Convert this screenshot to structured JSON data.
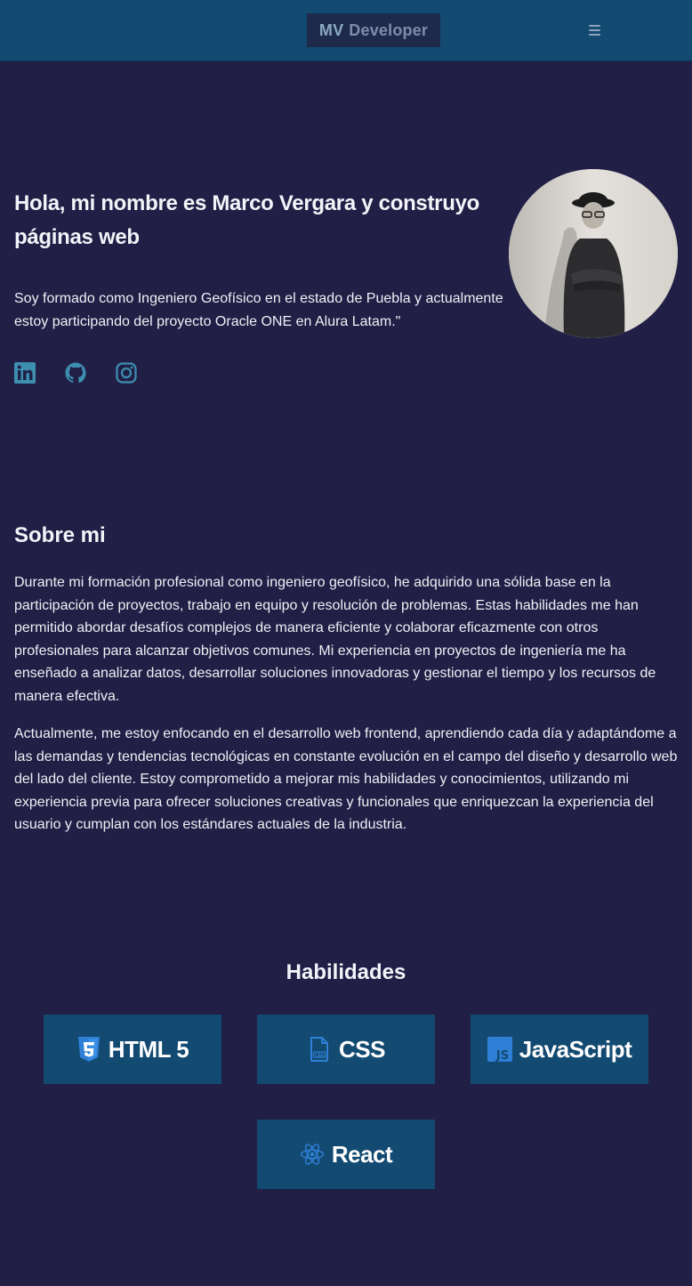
{
  "header": {
    "logo_initials": "MV",
    "logo_text": "Developer",
    "menu_icon": "hamburger-icon"
  },
  "hero": {
    "title": "Hola, mi nombre es Marco Vergara y construyo páginas web",
    "text": "Soy formado como Ingeniero Geofísico en el estado de Puebla y actualmente estoy participando del proyecto Oracle ONE en Alura Latam.\"",
    "socials": [
      {
        "icon": "linkedin-icon"
      },
      {
        "icon": "github-icon"
      },
      {
        "icon": "instagram-icon"
      }
    ]
  },
  "about": {
    "title": "Sobre mi",
    "paragraphs": [
      "Durante mi formación profesional como ingeniero geofísico, he adquirido una sólida base en la participación de proyectos, trabajo en equipo y resolución de problemas. Estas habilidades me han permitido abordar desafíos complejos de manera eficiente y colaborar eficazmente con otros profesionales para alcanzar objetivos comunes. Mi experiencia en proyectos de ingeniería me ha enseñado a analizar datos, desarrollar soluciones innovadoras y gestionar el tiempo y los recursos de manera efectiva.",
      "Actualmente, me estoy enfocando en el desarrollo web frontend, aprendiendo cada día y adaptándome a las demandas y tendencias tecnológicas en constante evolución en el campo del diseño y desarrollo web del lado del cliente. Estoy comprometido a mejorar mis habilidades y conocimientos, utilizando mi experiencia previa para ofrecer soluciones creativas y funcionales que enriquezcan la experiencia del usuario y cumplan con los estándares actuales de la industria."
    ]
  },
  "skills": {
    "title": "Habilidades",
    "items": [
      {
        "label": "HTML 5",
        "icon": "html5-icon"
      },
      {
        "label": "CSS",
        "icon": "css-file-icon"
      },
      {
        "label": "JavaScript",
        "icon": "javascript-icon"
      },
      {
        "label": "React",
        "icon": "react-icon"
      }
    ]
  },
  "colors": {
    "background": "#211f46",
    "header": "#134a71",
    "skill_card": "#134a71",
    "icon_accent": "#3d8fb0",
    "skill_icon": "#2f7fd6"
  }
}
